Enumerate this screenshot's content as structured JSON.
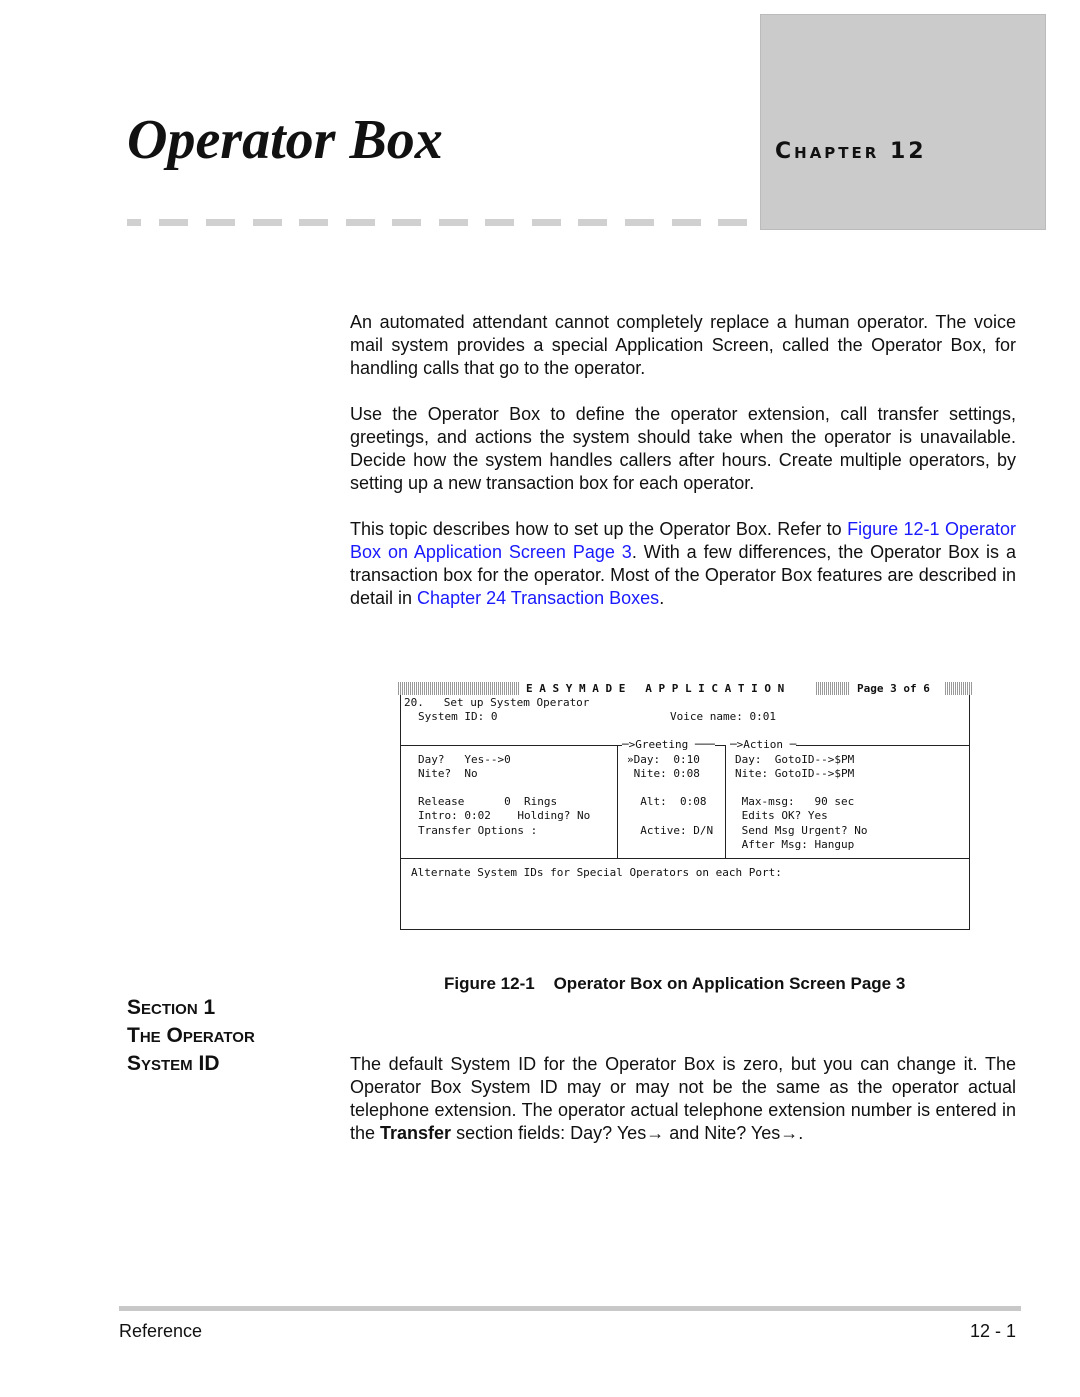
{
  "header": {
    "title": "Operator Box",
    "chapter_label": "Chapter 12"
  },
  "intro": {
    "p1": "An automated attendant cannot completely replace a human operator. The voice mail system provides a special Application Screen, called the Operator Box, for handling calls that go to the operator.",
    "p2": "Use the Operator Box to define the operator extension, call transfer settings, greetings, and actions the system should take when the operator is unavailable. Decide how the system handles callers after hours. Create multiple operators, by setting up a new transaction box for each operator.",
    "p3_a": "This topic describes how to set up the Operator Box. Refer to ",
    "p3_link1": "Figure 12-1 Operator Box on Application Screen Page 3",
    "p3_b": ". With a few differences, the Operator Box is a transaction box for the operator. Most of the Operator Box features are described in detail in ",
    "p3_link2": "Chapter 24 Transaction Boxes",
    "p3_c": "."
  },
  "screen": {
    "header": "E A S Y M A D E   A P P L I C A T I O N",
    "page": "Page 3 of 6",
    "line1": "20.   Set up System Operator",
    "system_id": "System ID: 0",
    "voice_name": "Voice name: 0:01",
    "greeting_hdr": "─>Greeting ───",
    "action_hdr": "─>Action ─",
    "day": "Day?   Yes-->0",
    "nite": "Nite?  No",
    "release": "Release      0  Rings",
    "intro": "Intro: 0:02    Holding? No",
    "transfer": "Transfer Options :",
    "g_day": "»Day:  0:10",
    "g_nite": " Nite: 0:08",
    "g_alt": "  Alt:  0:08",
    "g_active": "  Active: D/N",
    "a_day": "Day:  GotoID-->$PM",
    "a_nite": "Nite: GotoID-->$PM",
    "a_maxmsg": " Max-msg:   90 sec",
    "a_edits": " Edits OK? Yes",
    "a_urgent": " Send Msg Urgent? No",
    "a_after": " After Msg: Hangup",
    "alternate": "Alternate System IDs for Special Operators on each Port:"
  },
  "figure": {
    "caption": "Figure 12-1    Operator Box on Application Screen Page 3"
  },
  "section": {
    "line1": "Section 1",
    "line2": "The Operator",
    "line3": "System ID"
  },
  "body": {
    "p_a": "The default System ID for the Operator Box is zero, but you can change it. The Operator Box System ID may or may not be the same as the operator actual telephone extension. The operator actual telephone extension number is entered in the ",
    "p_bold": "Transfer",
    "p_b": " section fields: Day? Yes→  and  Nite? Yes→."
  },
  "footer": {
    "left": "Reference",
    "right": "12 - 1"
  }
}
